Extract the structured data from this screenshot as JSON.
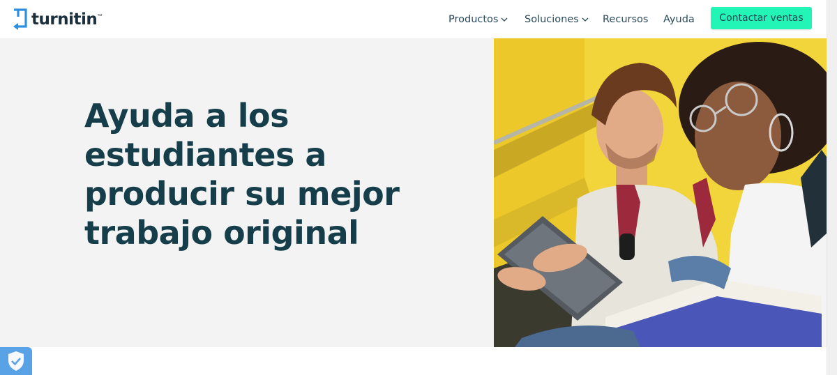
{
  "brand": {
    "name": "turnitin",
    "trademark": "™"
  },
  "nav": {
    "items": [
      {
        "label": "Productos",
        "has_dropdown": true
      },
      {
        "label": "Soluciones",
        "has_dropdown": true
      },
      {
        "label": "Recursos",
        "has_dropdown": false
      },
      {
        "label": "Ayuda",
        "has_dropdown": false
      }
    ],
    "cta_label": "Contactar ventas"
  },
  "hero": {
    "title": "Ayuda a los estudiantes a producir su mejor trabajo original"
  },
  "colors": {
    "accent": "#23f5b6",
    "title_text": "#163e4a",
    "nav_text": "#2a4a5a",
    "hero_bg": "#f3f3f3",
    "shield_badge": "#5aa2e6"
  },
  "icons": [
    "turnitin-logo-icon",
    "chevron-down-icon",
    "shield-check-icon"
  ]
}
